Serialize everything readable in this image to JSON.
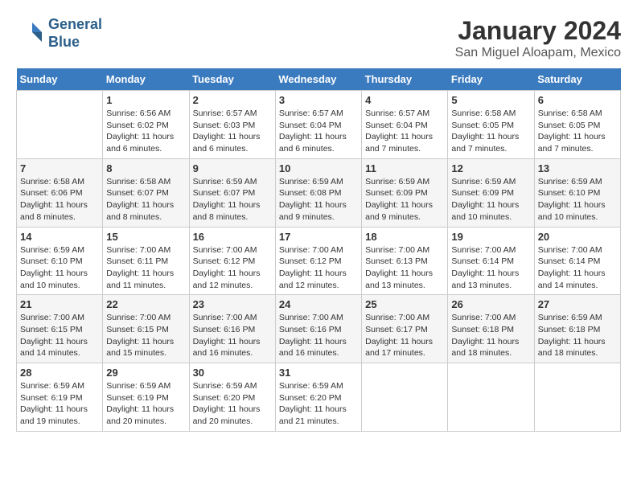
{
  "header": {
    "logo_line1": "General",
    "logo_line2": "Blue",
    "title": "January 2024",
    "subtitle": "San Miguel Aloapam, Mexico"
  },
  "calendar": {
    "days_of_week": [
      "Sunday",
      "Monday",
      "Tuesday",
      "Wednesday",
      "Thursday",
      "Friday",
      "Saturday"
    ],
    "weeks": [
      [
        {
          "day": "",
          "info": ""
        },
        {
          "day": "1",
          "info": "Sunrise: 6:56 AM\nSunset: 6:02 PM\nDaylight: 11 hours\nand 6 minutes."
        },
        {
          "day": "2",
          "info": "Sunrise: 6:57 AM\nSunset: 6:03 PM\nDaylight: 11 hours\nand 6 minutes."
        },
        {
          "day": "3",
          "info": "Sunrise: 6:57 AM\nSunset: 6:04 PM\nDaylight: 11 hours\nand 6 minutes."
        },
        {
          "day": "4",
          "info": "Sunrise: 6:57 AM\nSunset: 6:04 PM\nDaylight: 11 hours\nand 7 minutes."
        },
        {
          "day": "5",
          "info": "Sunrise: 6:58 AM\nSunset: 6:05 PM\nDaylight: 11 hours\nand 7 minutes."
        },
        {
          "day": "6",
          "info": "Sunrise: 6:58 AM\nSunset: 6:05 PM\nDaylight: 11 hours\nand 7 minutes."
        }
      ],
      [
        {
          "day": "7",
          "info": "Sunrise: 6:58 AM\nSunset: 6:06 PM\nDaylight: 11 hours\nand 8 minutes."
        },
        {
          "day": "8",
          "info": "Sunrise: 6:58 AM\nSunset: 6:07 PM\nDaylight: 11 hours\nand 8 minutes."
        },
        {
          "day": "9",
          "info": "Sunrise: 6:59 AM\nSunset: 6:07 PM\nDaylight: 11 hours\nand 8 minutes."
        },
        {
          "day": "10",
          "info": "Sunrise: 6:59 AM\nSunset: 6:08 PM\nDaylight: 11 hours\nand 9 minutes."
        },
        {
          "day": "11",
          "info": "Sunrise: 6:59 AM\nSunset: 6:09 PM\nDaylight: 11 hours\nand 9 minutes."
        },
        {
          "day": "12",
          "info": "Sunrise: 6:59 AM\nSunset: 6:09 PM\nDaylight: 11 hours\nand 10 minutes."
        },
        {
          "day": "13",
          "info": "Sunrise: 6:59 AM\nSunset: 6:10 PM\nDaylight: 11 hours\nand 10 minutes."
        }
      ],
      [
        {
          "day": "14",
          "info": "Sunrise: 6:59 AM\nSunset: 6:10 PM\nDaylight: 11 hours\nand 10 minutes."
        },
        {
          "day": "15",
          "info": "Sunrise: 7:00 AM\nSunset: 6:11 PM\nDaylight: 11 hours\nand 11 minutes."
        },
        {
          "day": "16",
          "info": "Sunrise: 7:00 AM\nSunset: 6:12 PM\nDaylight: 11 hours\nand 12 minutes."
        },
        {
          "day": "17",
          "info": "Sunrise: 7:00 AM\nSunset: 6:12 PM\nDaylight: 11 hours\nand 12 minutes."
        },
        {
          "day": "18",
          "info": "Sunrise: 7:00 AM\nSunset: 6:13 PM\nDaylight: 11 hours\nand 13 minutes."
        },
        {
          "day": "19",
          "info": "Sunrise: 7:00 AM\nSunset: 6:14 PM\nDaylight: 11 hours\nand 13 minutes."
        },
        {
          "day": "20",
          "info": "Sunrise: 7:00 AM\nSunset: 6:14 PM\nDaylight: 11 hours\nand 14 minutes."
        }
      ],
      [
        {
          "day": "21",
          "info": "Sunrise: 7:00 AM\nSunset: 6:15 PM\nDaylight: 11 hours\nand 14 minutes."
        },
        {
          "day": "22",
          "info": "Sunrise: 7:00 AM\nSunset: 6:15 PM\nDaylight: 11 hours\nand 15 minutes."
        },
        {
          "day": "23",
          "info": "Sunrise: 7:00 AM\nSunset: 6:16 PM\nDaylight: 11 hours\nand 16 minutes."
        },
        {
          "day": "24",
          "info": "Sunrise: 7:00 AM\nSunset: 6:16 PM\nDaylight: 11 hours\nand 16 minutes."
        },
        {
          "day": "25",
          "info": "Sunrise: 7:00 AM\nSunset: 6:17 PM\nDaylight: 11 hours\nand 17 minutes."
        },
        {
          "day": "26",
          "info": "Sunrise: 7:00 AM\nSunset: 6:18 PM\nDaylight: 11 hours\nand 18 minutes."
        },
        {
          "day": "27",
          "info": "Sunrise: 6:59 AM\nSunset: 6:18 PM\nDaylight: 11 hours\nand 18 minutes."
        }
      ],
      [
        {
          "day": "28",
          "info": "Sunrise: 6:59 AM\nSunset: 6:19 PM\nDaylight: 11 hours\nand 19 minutes."
        },
        {
          "day": "29",
          "info": "Sunrise: 6:59 AM\nSunset: 6:19 PM\nDaylight: 11 hours\nand 20 minutes."
        },
        {
          "day": "30",
          "info": "Sunrise: 6:59 AM\nSunset: 6:20 PM\nDaylight: 11 hours\nand 20 minutes."
        },
        {
          "day": "31",
          "info": "Sunrise: 6:59 AM\nSunset: 6:20 PM\nDaylight: 11 hours\nand 21 minutes."
        },
        {
          "day": "",
          "info": ""
        },
        {
          "day": "",
          "info": ""
        },
        {
          "day": "",
          "info": ""
        }
      ]
    ]
  }
}
